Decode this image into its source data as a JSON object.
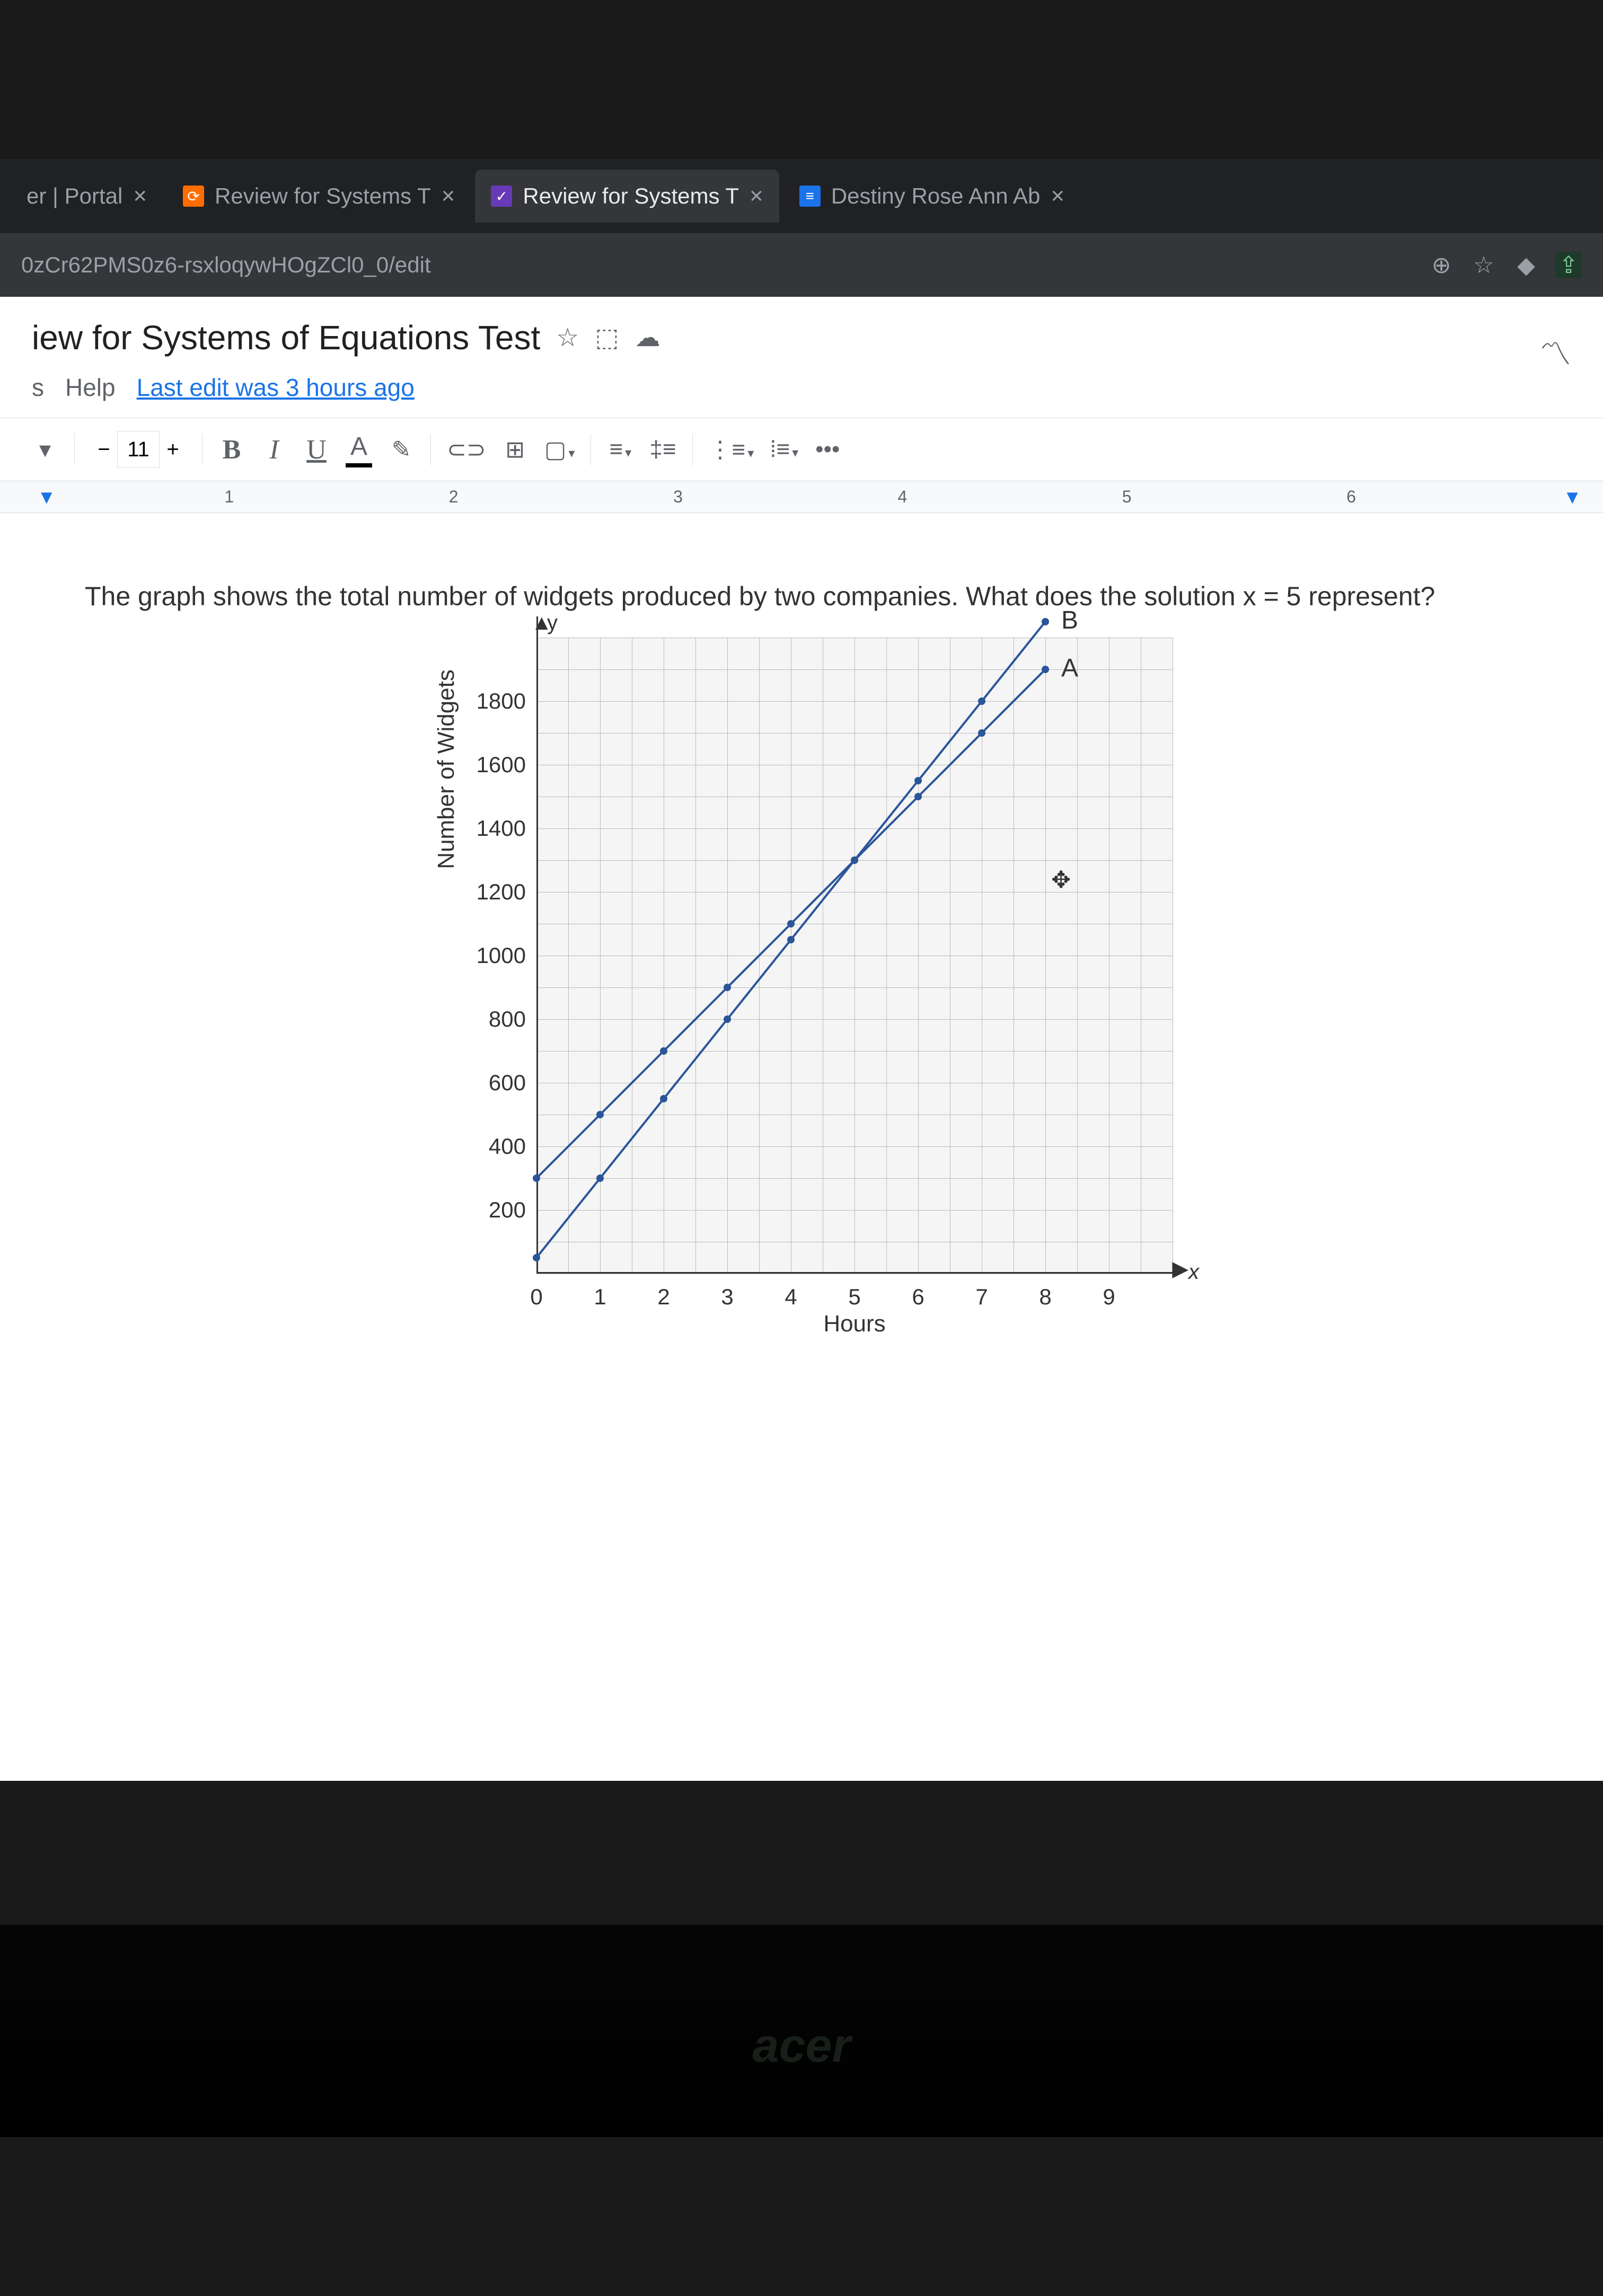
{
  "tabs": [
    {
      "label": "er | Portal",
      "favicon": ""
    },
    {
      "label": "Review for Systems T",
      "favicon": "⟳"
    },
    {
      "label": "Review for Systems T",
      "favicon": "✓"
    },
    {
      "label": "Destiny Rose Ann Ab",
      "favicon": "≡"
    }
  ],
  "url": "0zCr62PMS0z6-rsxloqywHOgZCl0_0/edit",
  "doc": {
    "title": "iew for Systems of Equations Test",
    "menu": {
      "help": "Help",
      "last_edit": "Last edit was 3 hours ago",
      "s": "s"
    },
    "toolbar": {
      "font_size": "11",
      "minus": "−",
      "plus": "+",
      "bold": "B",
      "italic": "I",
      "underline": "U",
      "text_color": "A",
      "highlight": "✎",
      "link": "⊂⊃",
      "comment": "⊞",
      "image": "▢",
      "align": "≡",
      "line_spacing": "‡≡",
      "numbered": "⋮≡",
      "bulleted": "⁞≡",
      "more": "•••"
    },
    "ruler": [
      "1",
      "2",
      "3",
      "4",
      "5",
      "6"
    ]
  },
  "content": {
    "question": "The graph shows the total number of widgets produced by two companies. What does the solution x = 5 represent?"
  },
  "chart_data": {
    "type": "line",
    "title": "",
    "xlabel": "Hours",
    "ylabel": "Number of Widgets",
    "y_axis_letter": "y",
    "x_axis_letter": "x",
    "xlim": [
      0,
      10
    ],
    "ylim": [
      0,
      2000
    ],
    "x_ticks": [
      0,
      1,
      2,
      3,
      4,
      5,
      6,
      7,
      8,
      9
    ],
    "y_ticks": [
      200,
      400,
      600,
      800,
      1000,
      1200,
      1400,
      1600,
      1800
    ],
    "series": [
      {
        "name": "A",
        "x": [
          0,
          1,
          2,
          3,
          4,
          5,
          6,
          7,
          8
        ],
        "y": [
          300,
          500,
          700,
          900,
          1100,
          1300,
          1500,
          1700,
          1900
        ]
      },
      {
        "name": "B",
        "x": [
          0,
          1,
          2,
          3,
          4,
          5,
          6,
          7,
          8
        ],
        "y": [
          50,
          300,
          550,
          800,
          1050,
          1300,
          1550,
          1800,
          2050
        ]
      }
    ]
  },
  "laptop_brand": "acer"
}
